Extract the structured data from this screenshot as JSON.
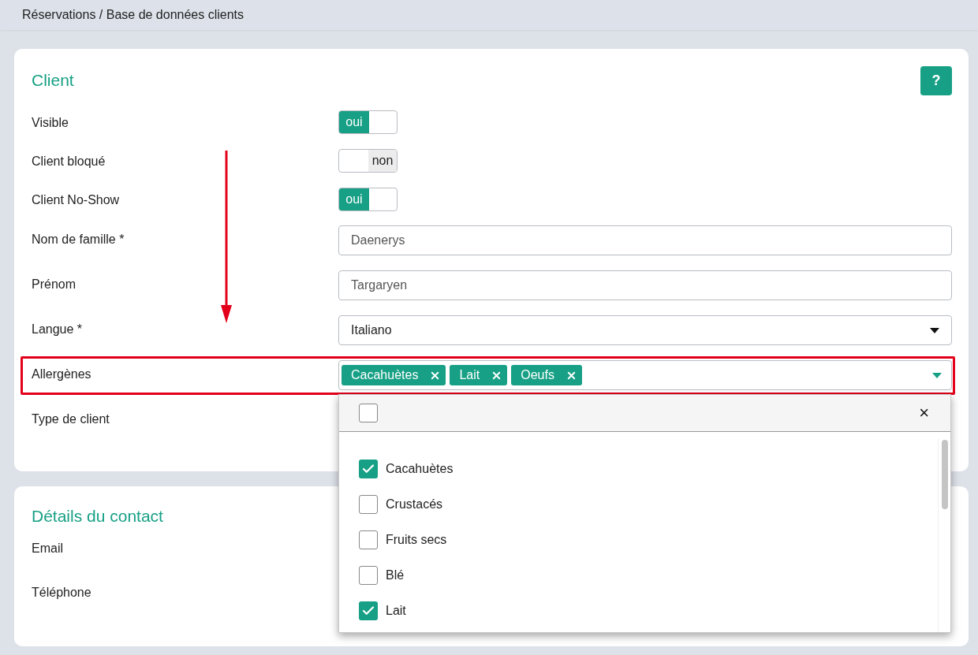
{
  "breadcrumb": "Réservations / Base de données clients",
  "client": {
    "title": "Client",
    "help_button": "?",
    "fields": [
      {
        "kind": "toggle",
        "label": "Visible",
        "on": true,
        "text": "oui"
      },
      {
        "kind": "toggle",
        "label": "Client bloqué",
        "on": false,
        "text": "non"
      },
      {
        "kind": "toggle",
        "label": "Client No-Show",
        "on": true,
        "text": "oui"
      },
      {
        "kind": "text",
        "label": "Nom de famille *",
        "value": "Daenerys"
      },
      {
        "kind": "text",
        "label": "Prénom",
        "value": "Targaryen"
      },
      {
        "kind": "select",
        "label": "Langue *",
        "value": "Italiano"
      },
      {
        "kind": "multiselect",
        "label": "Allergènes",
        "tags": [
          "Cacahuètes",
          "Lait",
          "Oeufs"
        ]
      },
      {
        "kind": "label",
        "label": "Type de client"
      }
    ]
  },
  "dropdown": {
    "select_all_checked": false,
    "close": "×",
    "options": [
      {
        "label": "Cacahuètes",
        "checked": true
      },
      {
        "label": "Crustacés",
        "checked": false
      },
      {
        "label": "Fruits secs",
        "checked": false
      },
      {
        "label": "Blé",
        "checked": false
      },
      {
        "label": "Lait",
        "checked": true
      }
    ]
  },
  "contact": {
    "title": "Détails du contact",
    "fields": [
      {
        "label": "Email"
      },
      {
        "label": "Téléphone"
      }
    ]
  }
}
